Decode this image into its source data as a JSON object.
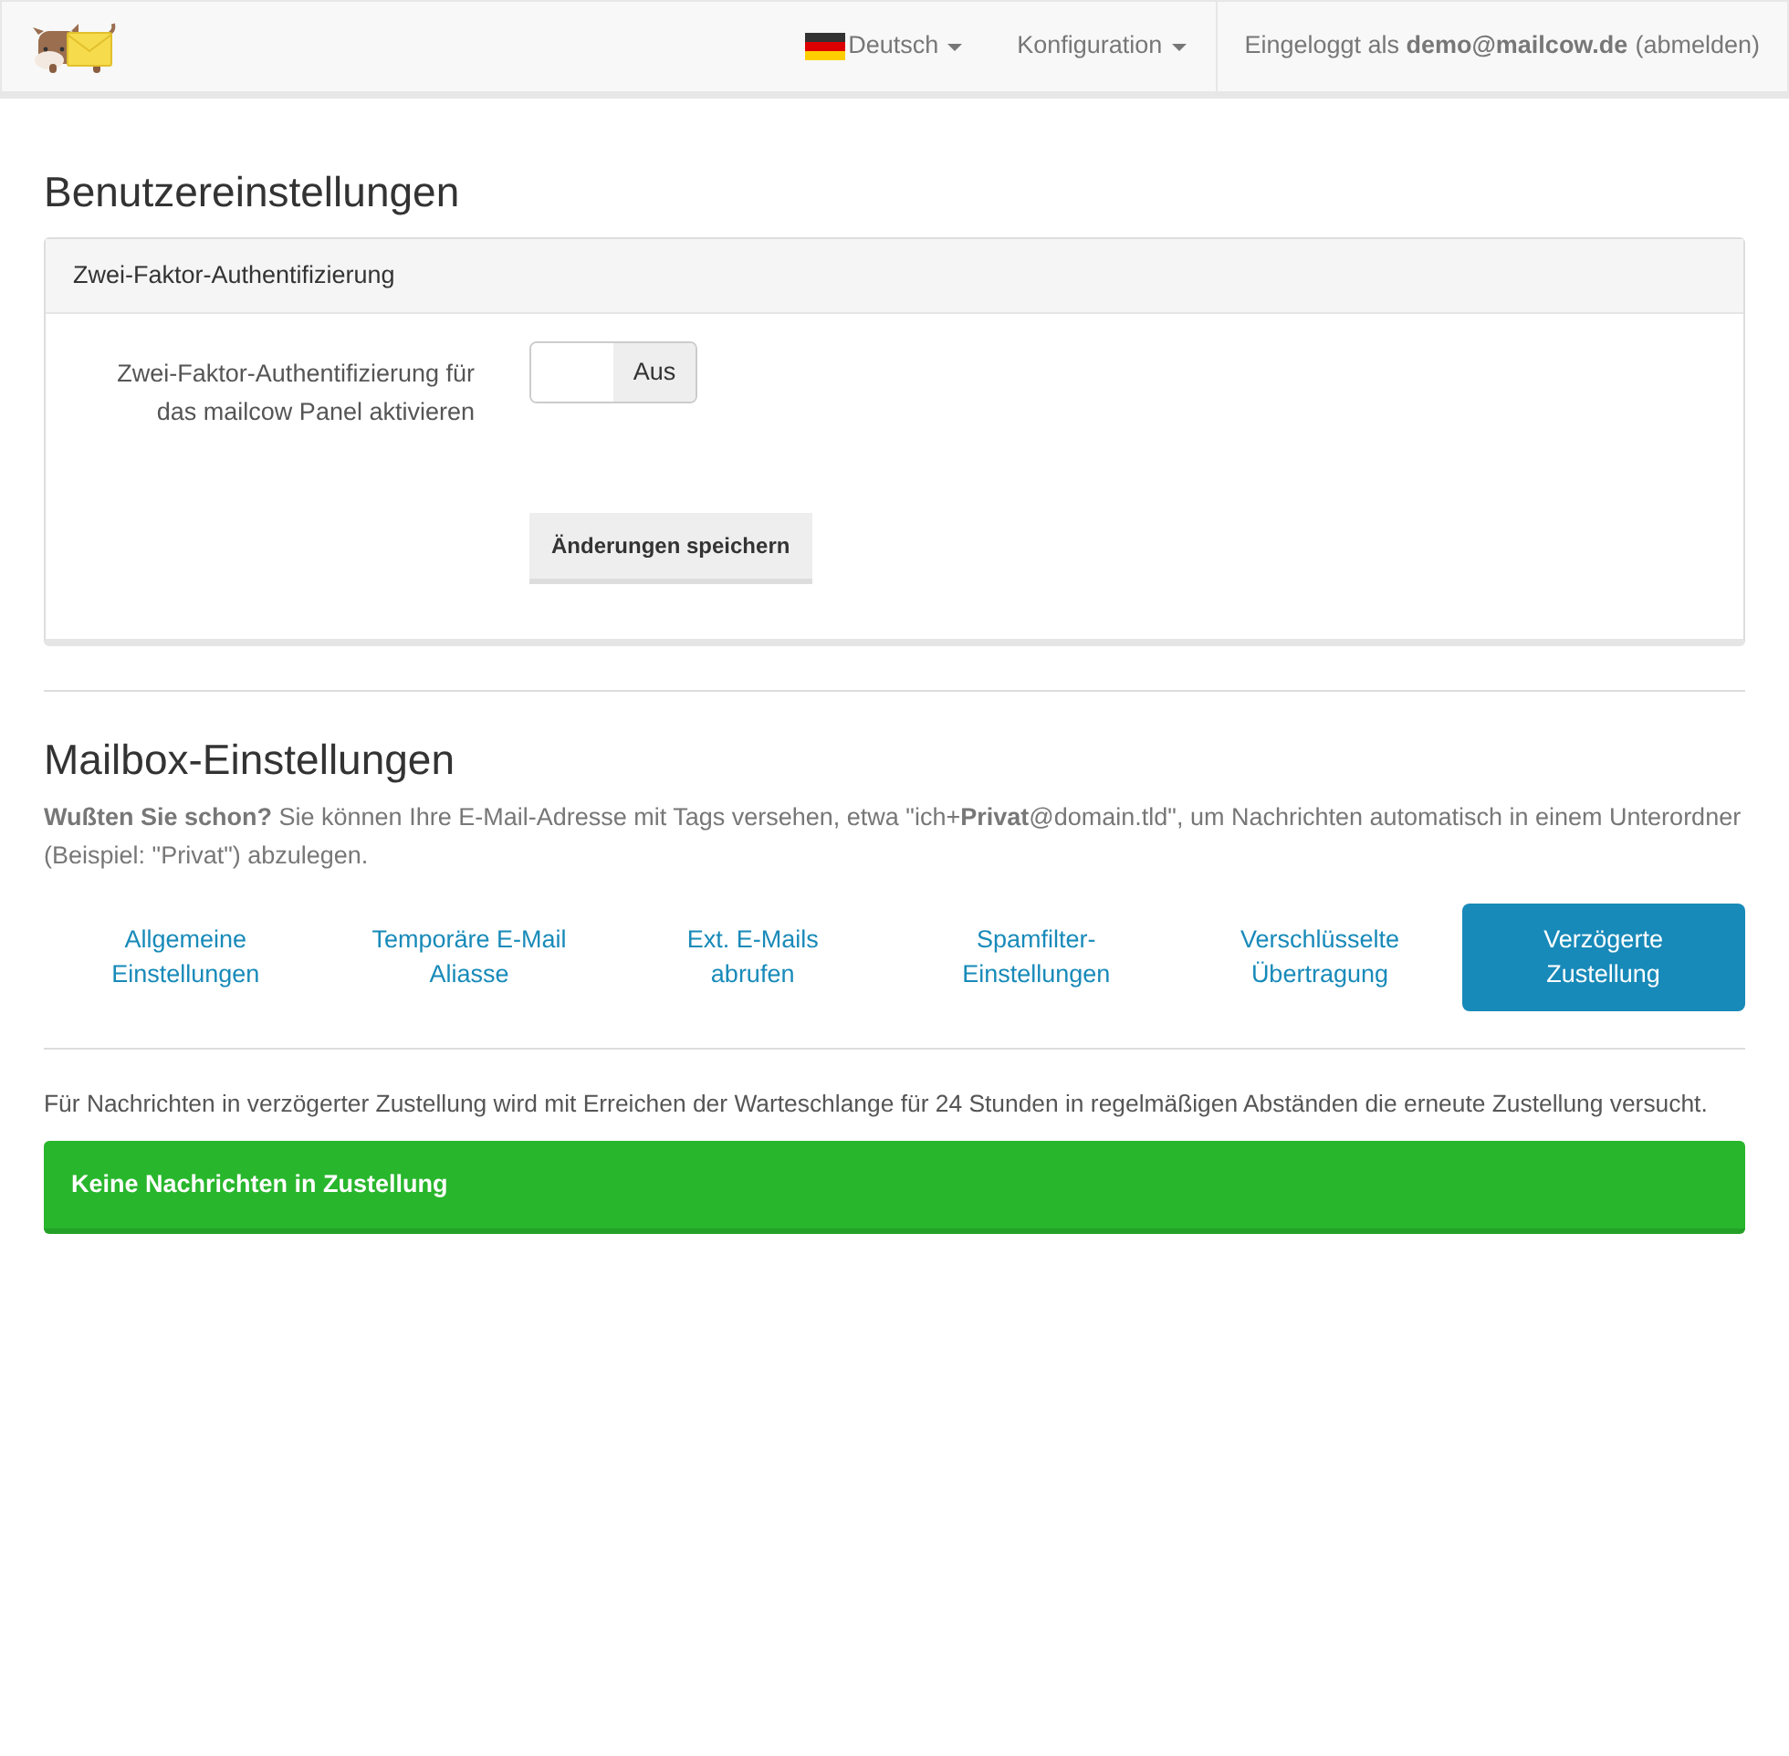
{
  "navbar": {
    "language": {
      "label": "Deutsch"
    },
    "menus": [
      {
        "label": "Konfiguration"
      }
    ],
    "login": {
      "text": "Eingeloggt als **demo@mailcow.de**",
      "logout": "(abmelden)"
    }
  },
  "user_settings": {
    "title": "Benutzereinstellungen",
    "panel": {
      "heading": "Zwei-Faktor-Authentifizierung",
      "toggle_label": "Zwei-Faktor-Authentifizierung für das mailcow Panel aktivieren",
      "toggle": {
        "on": false,
        "label": "Aus"
      },
      "save_button": "Änderungen speichern"
    }
  },
  "mailbox_settings": {
    "title": "Mailbox-Einstellungen",
    "tip": "**Wußten Sie schon?** Sie können Ihre E-Mail-Adresse mit Tags versehen, etwa \"ich+**Privat**@domain.tld\", um Nachrichten automatisch in einem Unterordner (Beispiel: \"Privat\") abzulegen.",
    "tabs": [
      {
        "label": "Allgemeine Einstellungen",
        "selected": false
      },
      {
        "label": "Temporäre E-Mail Aliasse",
        "selected": false
      },
      {
        "label": "Ext. E-Mails abrufen",
        "selected": false
      },
      {
        "label": "Spamfilter-Einstellungen",
        "selected": false
      },
      {
        "label": "Verschlüsselte Übertragung",
        "selected": false
      },
      {
        "label": "Verzögerte Zustellung",
        "selected": true
      }
    ],
    "description": "Für Nachrichten in verzögerter Zustellung wird mit Erreichen der Warteschlange für 24 Stunden in regelmäßigen Abständen die erneute Zustellung versucht.",
    "alert": "Keine Nachrichten in Zustellung"
  }
}
